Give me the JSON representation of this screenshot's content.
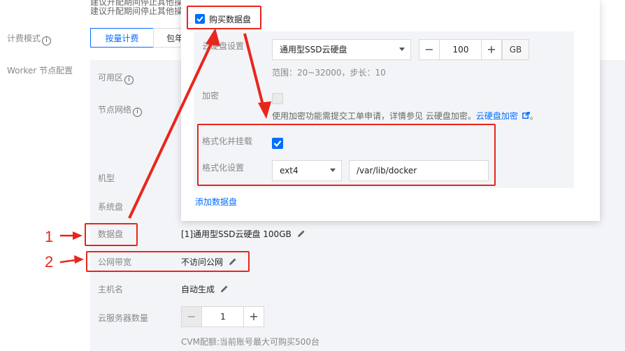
{
  "top_hint": {
    "line1": "建议升配期间停止其他操",
    "line2": "建议升配期间停止其他操"
  },
  "billing": {
    "label": "计费模式",
    "tabs": [
      {
        "label": "按量计费",
        "selected": true
      },
      {
        "label": "包年",
        "selected": false
      }
    ]
  },
  "worker": {
    "label": "Worker 节点配置",
    "fields": {
      "zone": "可用区",
      "network": "节点网络",
      "model": "机型",
      "system_disk": "系统盘",
      "data_disk": "数据盘",
      "bandwidth": "公网带宽",
      "hostname": "主机名",
      "server_count": "云服务器数量"
    },
    "values": {
      "data_disk": "[1]通用型SSD云硬盘 100GB",
      "bandwidth": "不访问公网",
      "hostname": "自动生成",
      "server_count": "1",
      "cvm_note": "CVM配额:当前账号最大可购买500台"
    }
  },
  "popup": {
    "buy_label": "购买数据盘",
    "buy_checked": true,
    "cloud_disk_label": "云硬盘设置",
    "disk_type": "通用型SSD云硬盘",
    "size_value": "100",
    "size_unit": "GB",
    "range_text": "范围：20~32000，步长：10",
    "encrypt_label": "加密",
    "encrypt_checked": false,
    "encrypt_note": "使用加密功能需提交工单申请，详情参见 云硬盘加密。",
    "encrypt_link": "云硬盘加密",
    "encrypt_tail": "。",
    "format_mount_label": "格式化并挂载",
    "format_mount_checked": true,
    "format_setting_label": "格式化设置",
    "fs_type": "ext4",
    "mount_path": "/var/lib/docker",
    "add_disk": "添加数据盘"
  },
  "annotations": {
    "marker1": "1",
    "marker2": "2"
  },
  "colors": {
    "accent": "#006eff",
    "annotation_red": "#e8261c"
  }
}
